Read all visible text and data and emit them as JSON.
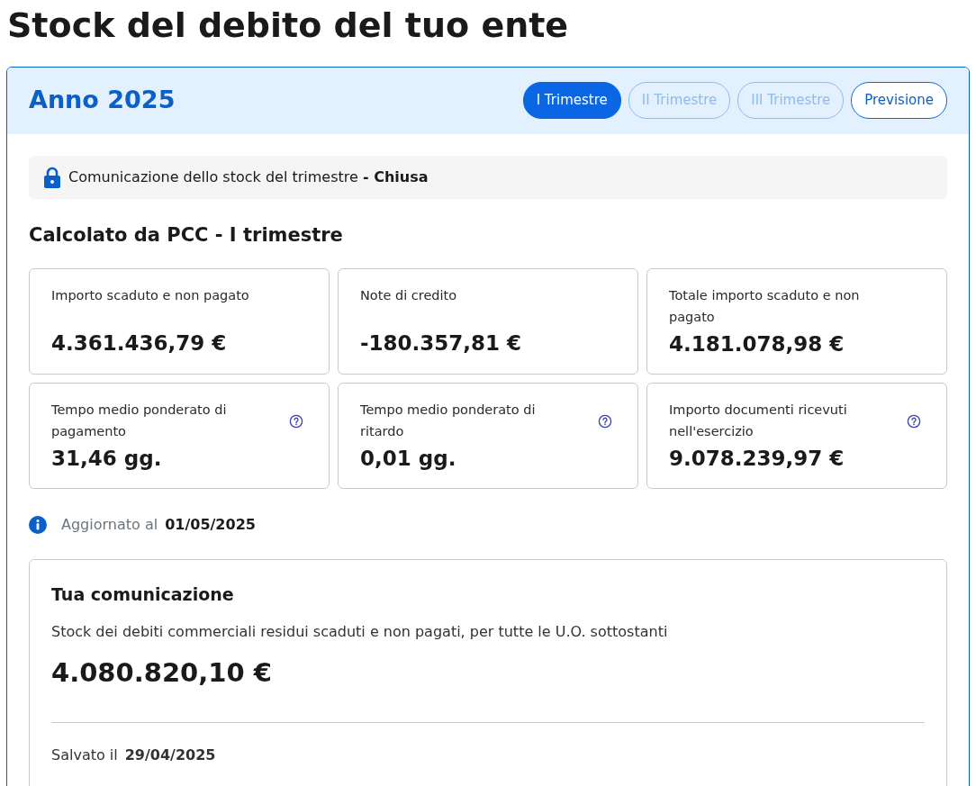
{
  "page_title": "Stock del debito del tuo ente",
  "year_title": "Anno 2025",
  "tabs": [
    {
      "label": "I Trimestre",
      "selected": true,
      "disabled": false
    },
    {
      "label": "II Trimestre",
      "selected": false,
      "disabled": true
    },
    {
      "label": "III Trimestre",
      "selected": false,
      "disabled": true
    },
    {
      "label": "Previsione",
      "selected": false,
      "disabled": false
    }
  ],
  "status": {
    "locked": true,
    "text": "Comunicazione dello stock del trimestre **- Chiusa**"
  },
  "section_title": "Calcolato da PCC - I trimestre",
  "metrics": [
    {
      "label": "Importo scaduto e non pagato",
      "value": "4.361.436,79 €",
      "help": false
    },
    {
      "label": "Note di credito",
      "value": "-180.357,81 €",
      "help": false
    },
    {
      "label": "Totale importo scaduto e non pagato",
      "value": "4.181.078,98 €",
      "help": false
    },
    {
      "label": "Tempo medio ponderato di pagamento",
      "value": "31,46 gg.",
      "help": true
    },
    {
      "label": "Tempo medio ponderato di ritardo",
      "value": "0,01 gg.",
      "help": true
    },
    {
      "label": "Importo documenti ricevuti nell'esercizio",
      "value": "9.078.239,97 €",
      "help": true
    }
  ],
  "updated": {
    "label": "Aggiornato al",
    "date": "01/05/2025"
  },
  "communication": {
    "title": "Tua comunicazione",
    "description": "Stock dei debiti commerciali residui scaduti e non pagati, per tutte le U.O. sottostanti",
    "amount": "4.080.820,10 €",
    "saved_label": "Salvato il",
    "saved_date": "29/04/2025"
  }
}
